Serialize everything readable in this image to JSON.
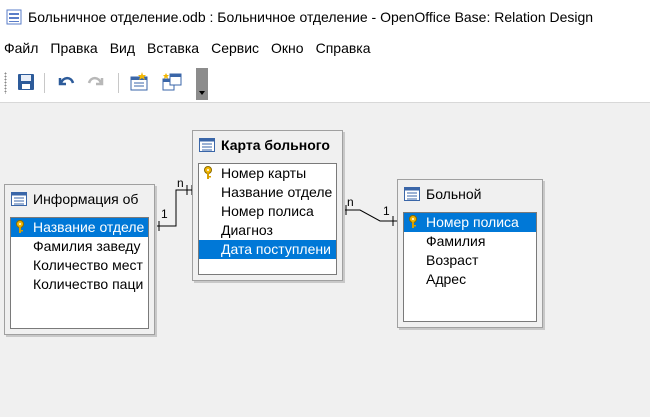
{
  "window": {
    "title": "Больничное отделение.odb : Больничное отделение - OpenOffice Base: Relation Design"
  },
  "menu": [
    "Файл",
    "Правка",
    "Вид",
    "Вставка",
    "Сервис",
    "Окно",
    "Справка"
  ],
  "toolbar": {
    "icons": [
      "save-icon",
      "undo-icon",
      "redo-icon",
      "new-relation-icon",
      "add-tables-icon"
    ]
  },
  "tables": {
    "info": {
      "title": "Информация об",
      "fields": [
        "Название отделе",
        "Фамилия заведу",
        "Количество мест",
        "Количество паци"
      ],
      "primary_key_index": 0,
      "selected_index": 0
    },
    "card": {
      "title": "Карта больного",
      "fields": [
        "Номер карты",
        "Название отделе",
        "Номер полиса",
        "Диагноз",
        "Дата поступлени"
      ],
      "primary_key_index": 0,
      "selected_index": 4
    },
    "patient": {
      "title": "Больной",
      "fields": [
        "Номер полиса",
        "Фамилия",
        "Возраст",
        "Адрес"
      ],
      "primary_key_index": 0,
      "selected_index": 0
    }
  },
  "relations": [
    {
      "from_label": "1",
      "to_label": "n"
    },
    {
      "from_label": "n",
      "to_label": "1"
    }
  ],
  "colors": {
    "selection": "#0078d7",
    "workspace": "#f0f0f0"
  }
}
